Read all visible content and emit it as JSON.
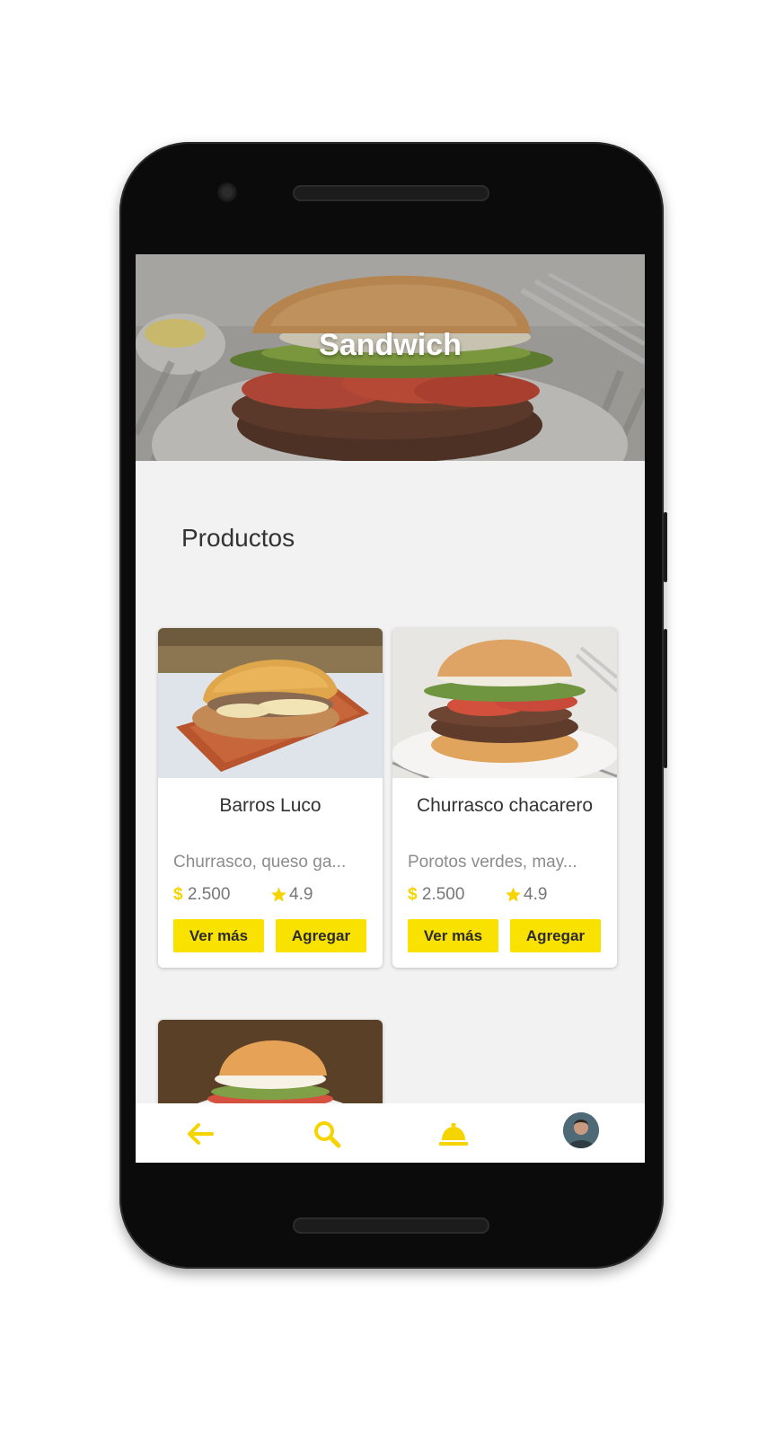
{
  "header": {
    "title": "Sandwich"
  },
  "section": {
    "title": "Productos"
  },
  "products": [
    {
      "name": "Barros Luco",
      "description": "Churrasco, queso ga...",
      "currency": "$",
      "price": "2.500",
      "rating": "4.9",
      "more_label": "Ver más",
      "add_label": "Agregar"
    },
    {
      "name": "Churrasco chacarero",
      "description": "Porotos verdes, may...",
      "currency": "$",
      "price": "2.500",
      "rating": "4.9",
      "more_label": "Ver más",
      "add_label": "Agregar"
    }
  ],
  "bottom_nav": {
    "items": [
      {
        "icon": "back-arrow-icon"
      },
      {
        "icon": "search-icon"
      },
      {
        "icon": "service-bell-icon"
      },
      {
        "icon": "profile-avatar"
      }
    ]
  },
  "colors": {
    "accent": "#f9e100",
    "background": "#f2f2f2",
    "text": "#333333",
    "muted": "#8c8c8c"
  }
}
